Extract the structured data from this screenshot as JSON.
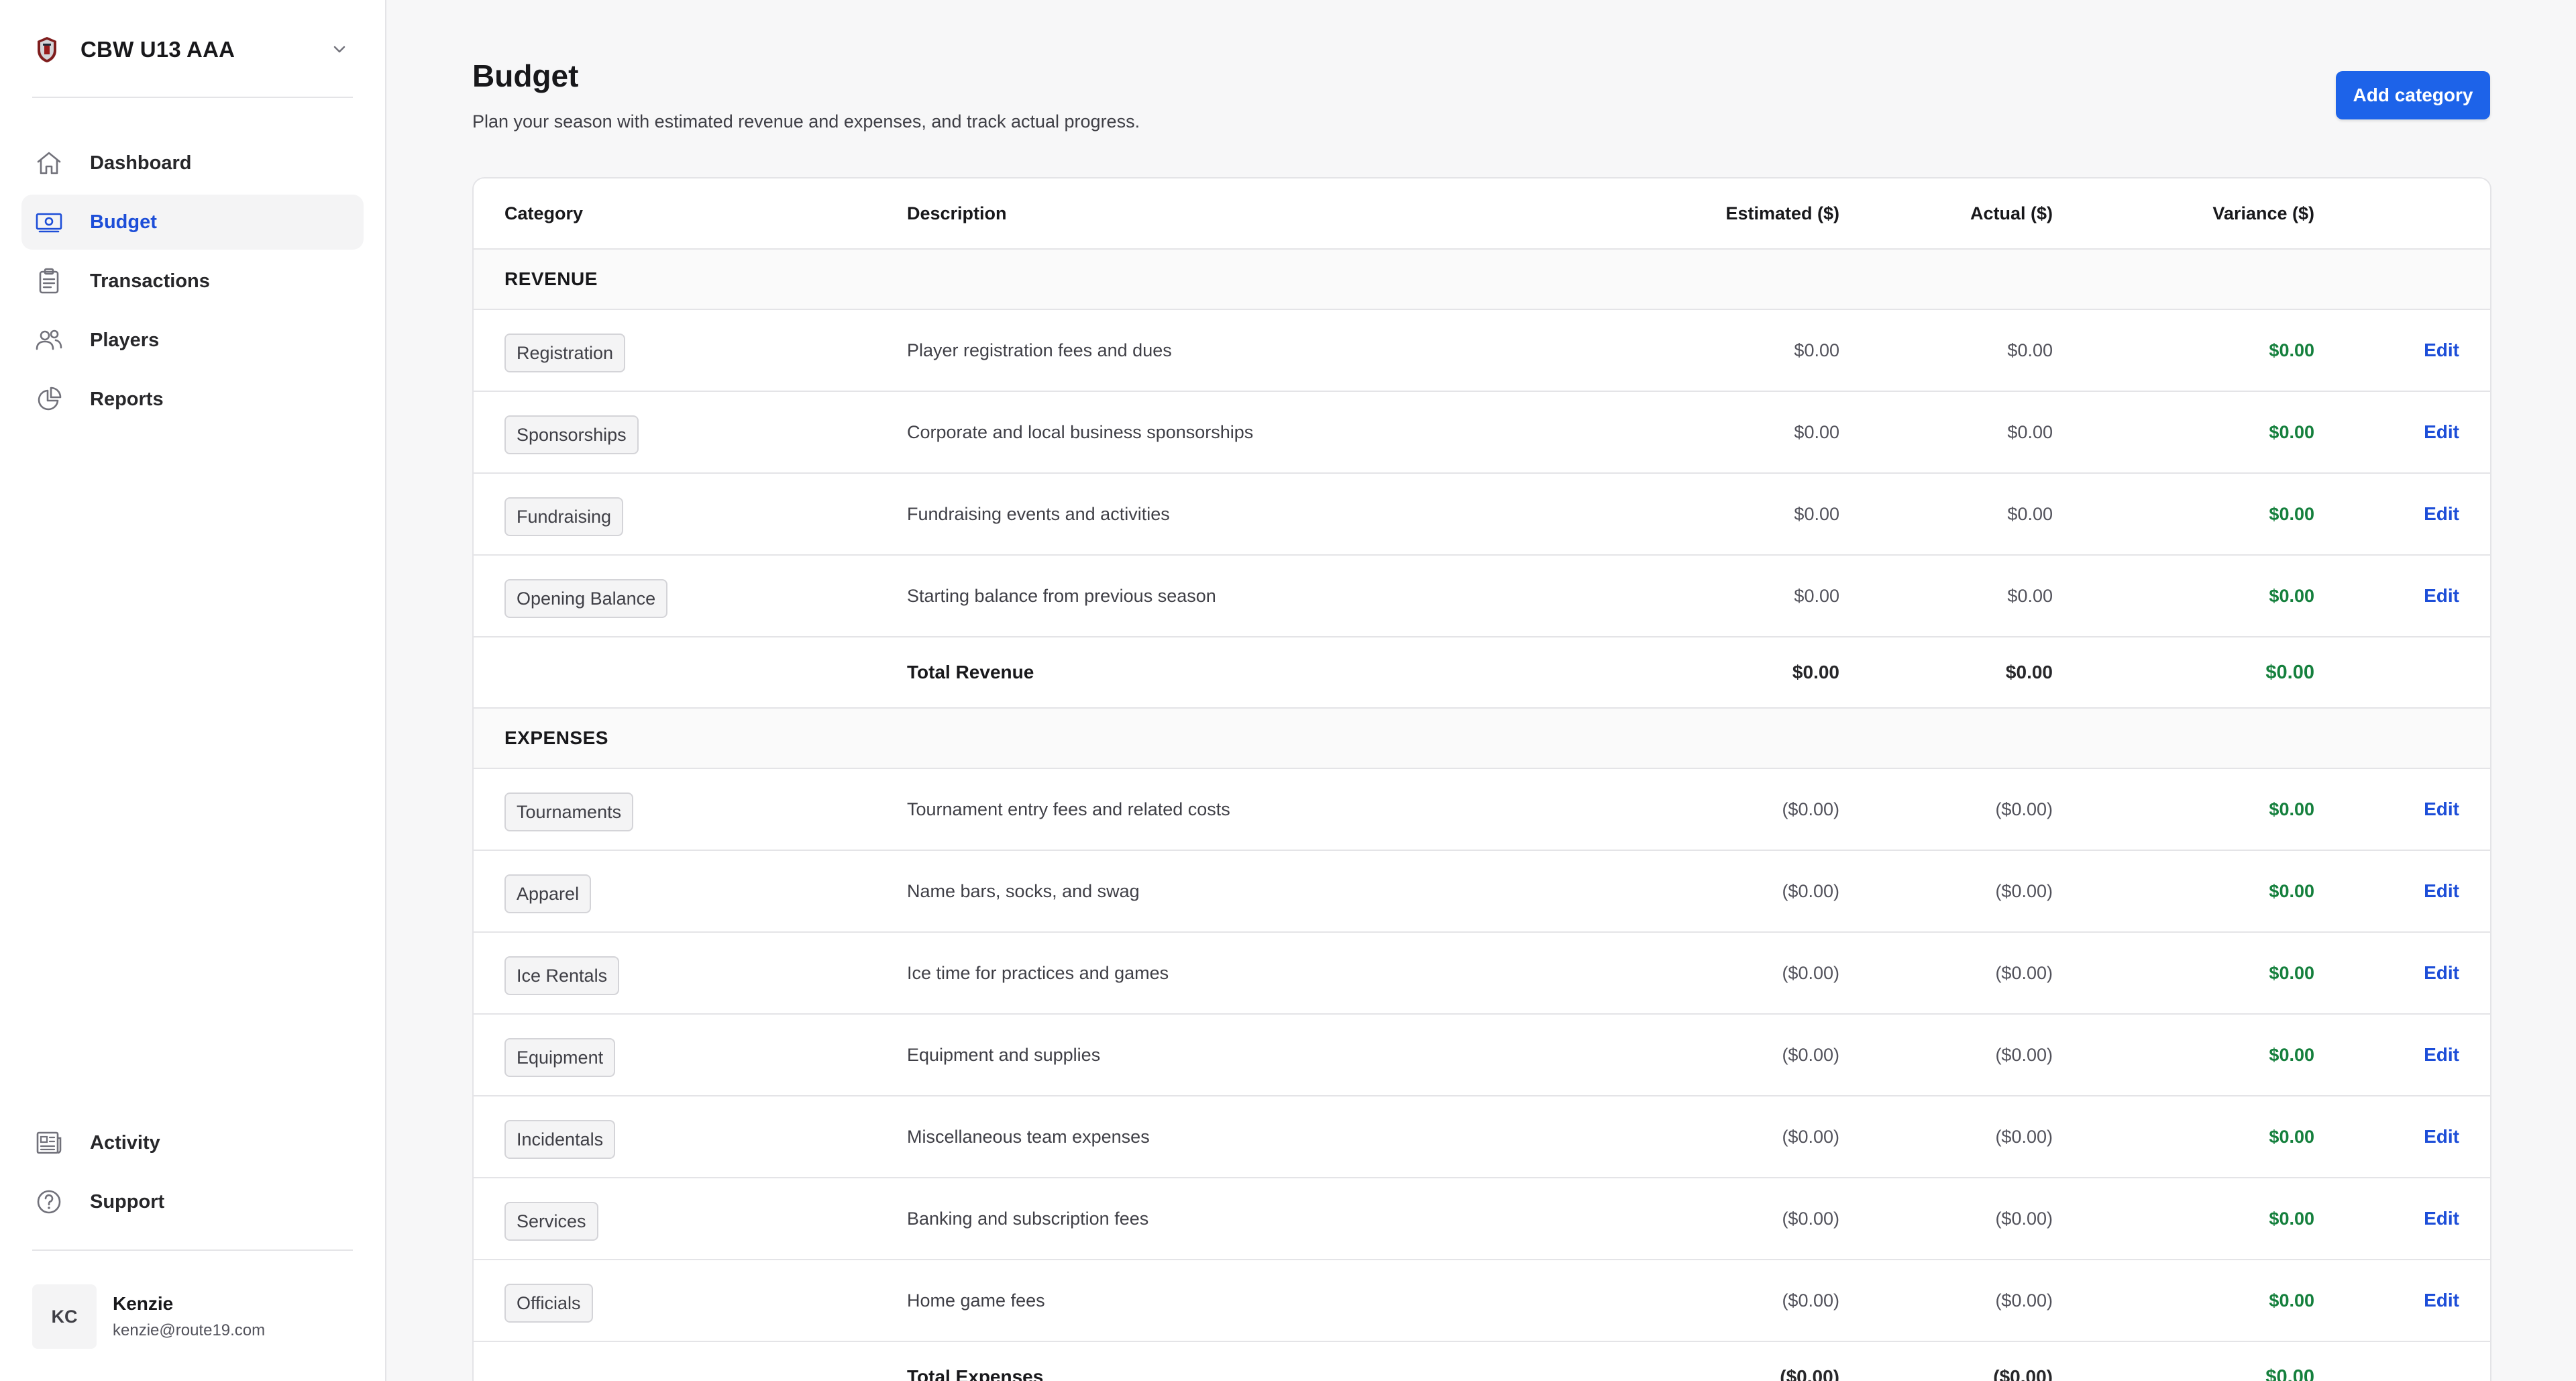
{
  "team": {
    "name": "CBW U13 AAA"
  },
  "nav": {
    "items": [
      {
        "label": "Dashboard",
        "icon": "home-icon"
      },
      {
        "label": "Budget",
        "icon": "budget-icon"
      },
      {
        "label": "Transactions",
        "icon": "clipboard-icon"
      },
      {
        "label": "Players",
        "icon": "users-icon"
      },
      {
        "label": "Reports",
        "icon": "pie-chart-icon"
      }
    ],
    "bottom": [
      {
        "label": "Activity",
        "icon": "newspaper-icon"
      },
      {
        "label": "Support",
        "icon": "help-circle-icon"
      }
    ]
  },
  "user": {
    "initials": "KC",
    "name": "Kenzie",
    "email": "kenzie@route19.com"
  },
  "page": {
    "title": "Budget",
    "subtitle": "Plan your season with estimated revenue and expenses, and track actual progress.",
    "add_button": "Add category"
  },
  "table": {
    "headers": {
      "category": "Category",
      "description": "Description",
      "estimated": "Estimated ($)",
      "actual": "Actual ($)",
      "variance": "Variance ($)"
    },
    "edit_label": "Edit",
    "revenue": {
      "title": "REVENUE",
      "rows": [
        {
          "category": "Registration",
          "description": "Player registration fees and dues",
          "estimated": "$0.00",
          "actual": "$0.00",
          "variance": "$0.00"
        },
        {
          "category": "Sponsorships",
          "description": "Corporate and local business sponsorships",
          "estimated": "$0.00",
          "actual": "$0.00",
          "variance": "$0.00"
        },
        {
          "category": "Fundraising",
          "description": "Fundraising events and activities",
          "estimated": "$0.00",
          "actual": "$0.00",
          "variance": "$0.00"
        },
        {
          "category": "Opening Balance",
          "description": "Starting balance from previous season",
          "estimated": "$0.00",
          "actual": "$0.00",
          "variance": "$0.00"
        }
      ],
      "total": {
        "label": "Total Revenue",
        "estimated": "$0.00",
        "actual": "$0.00",
        "variance": "$0.00"
      }
    },
    "expenses": {
      "title": "EXPENSES",
      "rows": [
        {
          "category": "Tournaments",
          "description": "Tournament entry fees and related costs",
          "estimated": "($0.00)",
          "actual": "($0.00)",
          "variance": "$0.00"
        },
        {
          "category": "Apparel",
          "description": "Name bars, socks, and swag",
          "estimated": "($0.00)",
          "actual": "($0.00)",
          "variance": "$0.00"
        },
        {
          "category": "Ice Rentals",
          "description": "Ice time for practices and games",
          "estimated": "($0.00)",
          "actual": "($0.00)",
          "variance": "$0.00"
        },
        {
          "category": "Equipment",
          "description": "Equipment and supplies",
          "estimated": "($0.00)",
          "actual": "($0.00)",
          "variance": "$0.00"
        },
        {
          "category": "Incidentals",
          "description": "Miscellaneous team expenses",
          "estimated": "($0.00)",
          "actual": "($0.00)",
          "variance": "$0.00"
        },
        {
          "category": "Services",
          "description": "Banking and subscription fees",
          "estimated": "($0.00)",
          "actual": "($0.00)",
          "variance": "$0.00"
        },
        {
          "category": "Officials",
          "description": "Home game fees",
          "estimated": "($0.00)",
          "actual": "($0.00)",
          "variance": "$0.00"
        }
      ],
      "total": {
        "label": "Total Expenses",
        "estimated": "($0.00)",
        "actual": "($0.00)",
        "variance": "$0.00"
      }
    }
  },
  "colors": {
    "accent": "#1d63e9",
    "link": "#1d4ed8",
    "positive": "#15803d",
    "border": "#e4e4e7"
  }
}
